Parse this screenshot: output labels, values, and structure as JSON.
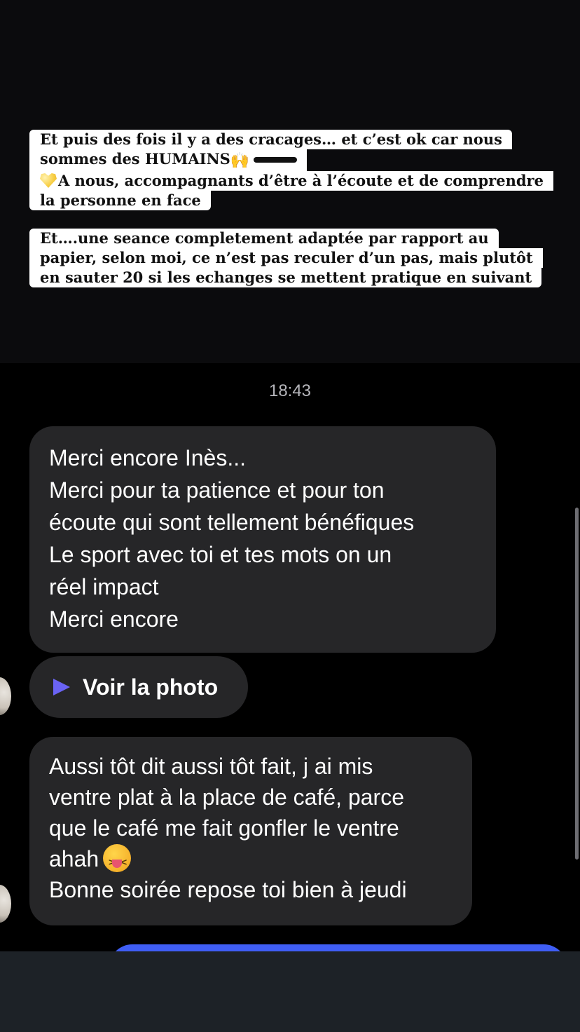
{
  "story": {
    "note_1": {
      "line_1": "Et puis des fois il y a des cracages… et c’est ok car nous",
      "line_2_text": "sommes des HUMAINS",
      "line_2_emoji": "🙌",
      "line_3_text": "A nous, accompagnants d’être à l’écoute et de comprendre",
      "line_4": "la personne en face"
    },
    "note_2": {
      "line_1": "Et….une seance completement adaptée par rapport au",
      "line_2": "papier, selon moi, ce n’est pas reculer d’un pas, mais plutôt",
      "line_3": "en sauter 20 si les echanges  se mettent pratique en suivant"
    }
  },
  "chat": {
    "timestamp": "18:43",
    "messages": [
      {
        "lines": [
          "Merci encore Inès...",
          "Merci pour ta patience et pour ton",
          "écoute qui sont tellement  bénéfiques",
          "Le sport avec toi et tes mots on un",
          "réel impact",
          "Merci encore"
        ]
      },
      {
        "photo_label": "Voir la photo"
      },
      {
        "lines": [
          "Aussi tôt dit aussi tôt fait, j ai mis",
          "ventre plat à la place de café, parce",
          "que le café me fait gonfler le ventre",
          "ahah",
          "Bonne soirée repose toi bien à jeudi"
        ]
      }
    ]
  },
  "colors": {
    "background": "#000000",
    "received_bubble": "#262628",
    "sent_bubble": "#3f5ef5",
    "play_accent": "#6a63f5"
  },
  "icons": [
    "yellow-heart-icon",
    "raised-hands-icon",
    "play-icon",
    "squinting-tongue-emoji-icon",
    "avatar"
  ]
}
